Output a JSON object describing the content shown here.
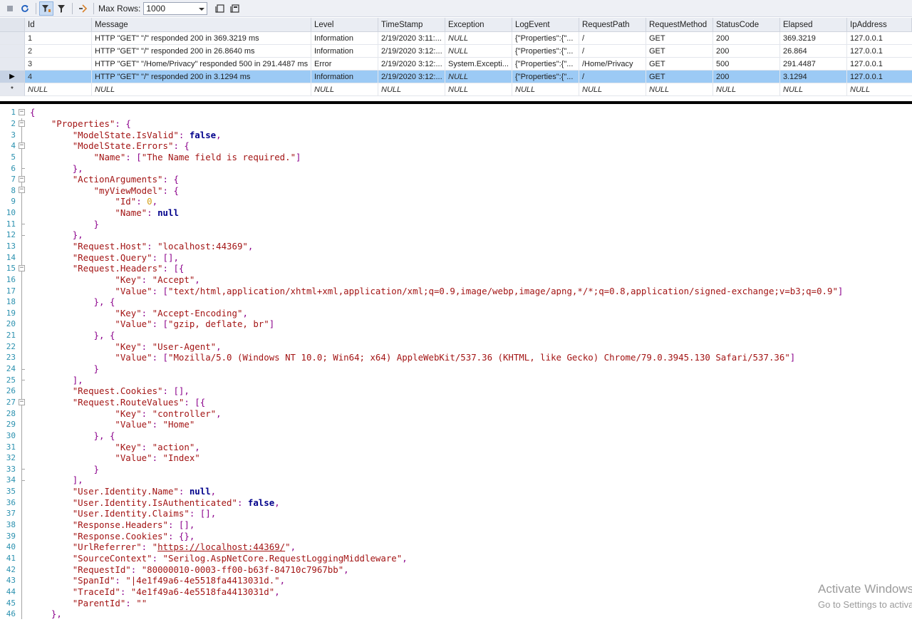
{
  "toolbar": {
    "max_rows_label": "Max Rows:",
    "max_rows_value": "1000"
  },
  "grid": {
    "columns": [
      "Id",
      "Message",
      "Level",
      "TimeStamp",
      "Exception",
      "LogEvent",
      "RequestPath",
      "RequestMethod",
      "StatusCode",
      "Elapsed",
      "IpAddress"
    ],
    "rows": [
      {
        "id": "1",
        "message": "HTTP \"GET\" \"/\" responded 200 in 369.3219 ms",
        "level": "Information",
        "timestamp": "2/19/2020 3:11:...",
        "exception": "NULL",
        "logevent": "{\"Properties\":{\"...",
        "requestpath": "/",
        "requestmethod": "GET",
        "statuscode": "200",
        "elapsed": "369.3219",
        "ipaddress": "127.0.0.1"
      },
      {
        "id": "2",
        "message": "HTTP \"GET\" \"/\" responded 200 in 26.8640 ms",
        "level": "Information",
        "timestamp": "2/19/2020 3:12:...",
        "exception": "NULL",
        "logevent": "{\"Properties\":{\"...",
        "requestpath": "/",
        "requestmethod": "GET",
        "statuscode": "200",
        "elapsed": "26.864",
        "ipaddress": "127.0.0.1"
      },
      {
        "id": "3",
        "message": "HTTP \"GET\" \"/Home/Privacy\" responded 500 in 291.4487 ms",
        "level": "Error",
        "timestamp": "2/19/2020 3:12:...",
        "exception": "System.Excepti...",
        "logevent": "{\"Properties\":{\"...",
        "requestpath": "/Home/Privacy",
        "requestmethod": "GET",
        "statuscode": "500",
        "elapsed": "291.4487",
        "ipaddress": "127.0.0.1"
      },
      {
        "id": "4",
        "message": "HTTP \"GET\" \"/\" responded 200 in 3.1294 ms",
        "level": "Information",
        "timestamp": "2/19/2020 3:12:...",
        "exception": "NULL",
        "logevent": "{\"Properties\":{\"...",
        "requestpath": "/",
        "requestmethod": "GET",
        "statuscode": "200",
        "elapsed": "3.1294",
        "ipaddress": "127.0.0.1"
      }
    ],
    "new_row": [
      "NULL",
      "NULL",
      "NULL",
      "NULL",
      "NULL",
      "NULL",
      "NULL",
      "NULL",
      "NULL",
      "NULL",
      "NULL"
    ],
    "selected_row": 3
  },
  "editor": {
    "lines": [
      "{",
      "    \"Properties\": {",
      "        \"ModelState.IsValid\": false,",
      "        \"ModelState.Errors\": {",
      "            \"Name\": [\"The Name field is required.\"]",
      "        },",
      "        \"ActionArguments\": {",
      "            \"myViewModel\": {",
      "                \"Id\": 0,",
      "                \"Name\": null",
      "            }",
      "        },",
      "        \"Request.Host\": \"localhost:44369\",",
      "        \"Request.Query\": [],",
      "        \"Request.Headers\": [{",
      "                \"Key\": \"Accept\",",
      "                \"Value\": [\"text/html,application/xhtml+xml,application/xml;q=0.9,image/webp,image/apng,*/*;q=0.8,application/signed-exchange;v=b3;q=0.9\"]",
      "            }, {",
      "                \"Key\": \"Accept-Encoding\",",
      "                \"Value\": [\"gzip, deflate, br\"]",
      "            }, {",
      "                \"Key\": \"User-Agent\",",
      "                \"Value\": [\"Mozilla/5.0 (Windows NT 10.0; Win64; x64) AppleWebKit/537.36 (KHTML, like Gecko) Chrome/79.0.3945.130 Safari/537.36\"]",
      "            }",
      "        ],",
      "        \"Request.Cookies\": [],",
      "        \"Request.RouteValues\": [{",
      "                \"Key\": \"controller\",",
      "                \"Value\": \"Home\"",
      "            }, {",
      "                \"Key\": \"action\",",
      "                \"Value\": \"Index\"",
      "            }",
      "        ],",
      "        \"User.Identity.Name\": null,",
      "        \"User.Identity.IsAuthenticated\": false,",
      "        \"User.Identity.Claims\": [],",
      "        \"Response.Headers\": [],",
      "        \"Response.Cookies\": {},",
      "        \"UrlReferrer\": \"https://localhost:44369/\",",
      "        \"SourceContext\": \"Serilog.AspNetCore.RequestLoggingMiddleware\",",
      "        \"RequestId\": \"80000010-0003-ff00-b63f-84710c7967bb\",",
      "        \"SpanId\": \"|4e1f49a6-4e5518fa4413031d.\",",
      "        \"TraceId\": \"4e1f49a6-4e5518fa4413031d\",",
      "        \"ParentId\": \"\"",
      "    },"
    ],
    "url_text": "https://localhost:44369/"
  },
  "watermark": {
    "line1": "Activate Windows",
    "line2": "Go to Settings to activate Windows."
  },
  "icons": [
    "stop-icon",
    "refresh-icon",
    "filter-active-icon",
    "filter-icon",
    "run-step-icon",
    "toggle-pane-icon",
    "toggle-pane2-icon",
    "dropdown-arrow-icon"
  ]
}
